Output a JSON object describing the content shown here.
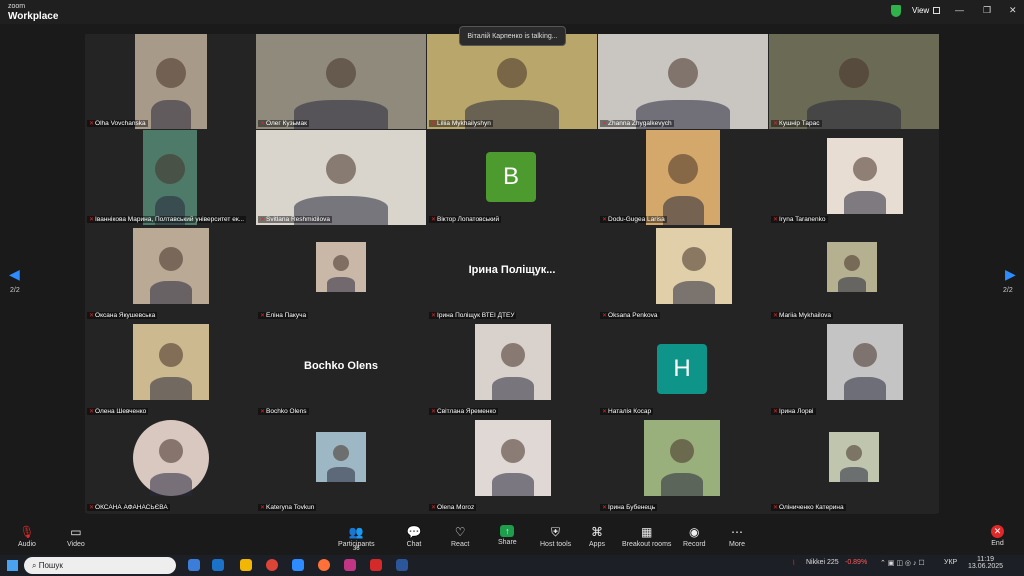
{
  "titlebar": {
    "brand_small": "zoom",
    "brand_big": "Workplace",
    "view_label": "View"
  },
  "talking_banner": "Віталій Карпенко is talking...",
  "colors": {
    "mic_muted": "#e02828",
    "accent": "#2d8cff"
  },
  "tiles": [
    {
      "name": "Olha Vovchanska",
      "kind": "photo",
      "bg": "#a89a88"
    },
    {
      "name": "Олег Кузьмак",
      "kind": "photo",
      "bg": "#8f8a7c"
    },
    {
      "name": "Liliia Mykhailyshyn",
      "kind": "photo",
      "bg": "#b8a66a"
    },
    {
      "name": "Zhanna Zhygalkevych",
      "kind": "photo",
      "bg": "#c9c6c2"
    },
    {
      "name": "Кушнір Тарас",
      "kind": "photo",
      "bg": "#6b6a55"
    },
    {
      "name": "Іваннікова Марина, Полтавський університет ек...",
      "kind": "photo",
      "bg": "#4e7a6a"
    },
    {
      "name": "Svitlana Reshmidilova",
      "kind": "photo",
      "bg": "#d9d4cc"
    },
    {
      "name": "Віктор Лопатовський",
      "kind": "avatar",
      "letter": "B",
      "color": "#4d9a2f"
    },
    {
      "name": "Dodu-Gugea Larisa",
      "kind": "photo",
      "bg": "#d4a86a"
    },
    {
      "name": "Iryna Taranenko",
      "kind": "photo",
      "bg": "#e8ddd2"
    },
    {
      "name": "Оксана Якушевська",
      "kind": "photo",
      "bg": "#b9a995"
    },
    {
      "name": "Еліна Пакуча",
      "kind": "photo",
      "bg": "#c9b8a8"
    },
    {
      "name": "Ірина Поліщук ВТЕІ ДТЕУ",
      "kind": "name",
      "display": "Ірина Поліщук..."
    },
    {
      "name": "Oksana Penkova",
      "kind": "photo",
      "bg": "#e0cfa8"
    },
    {
      "name": "Mariia Mykhailova",
      "kind": "photo",
      "bg": "#b4b090"
    },
    {
      "name": "Олена Шевченко",
      "kind": "photo",
      "bg": "#cdb98f"
    },
    {
      "name": "Bochko Olens",
      "kind": "name",
      "display": "Bochko Olens"
    },
    {
      "name": "Світлана Яременко",
      "kind": "photo",
      "bg": "#d9d2cc"
    },
    {
      "name": "Наталія Косар",
      "kind": "avatar",
      "letter": "H",
      "color": "#0e9488"
    },
    {
      "name": "Ірина Лорві",
      "kind": "photo",
      "bg": "#c4c4c4"
    },
    {
      "name": "ОКСАНА АФАНАСЬЄВА",
      "kind": "photo",
      "bg": "#d8c8c0"
    },
    {
      "name": "Kateryna Tovkun",
      "kind": "photo",
      "bg": "#9db8c4"
    },
    {
      "name": "Olena Moroz",
      "kind": "photo",
      "bg": "#e0d8d4"
    },
    {
      "name": "Ірина Бубенець",
      "kind": "photo",
      "bg": "#9ab07c"
    },
    {
      "name": "Оліниченко Катерина",
      "kind": "photo",
      "bg": "#bfc6ad"
    }
  ],
  "pager": {
    "left": "2/2",
    "right": "2/2"
  },
  "toolbar": {
    "audio": "Audio",
    "video": "Video",
    "participants": "Participants",
    "participants_count": "36",
    "chat": "Chat",
    "react": "React",
    "share": "Share",
    "host_tools": "Host tools",
    "apps": "Apps",
    "breakout": "Breakout rooms",
    "record": "Record",
    "more": "More",
    "end": "End"
  },
  "taskbar": {
    "search_placeholder": "Пошук",
    "ticker": "Nikkei 225",
    "ticker_change": "-0.89%",
    "lang": "УКР",
    "time": "11:19",
    "date": "13.06.2025"
  }
}
